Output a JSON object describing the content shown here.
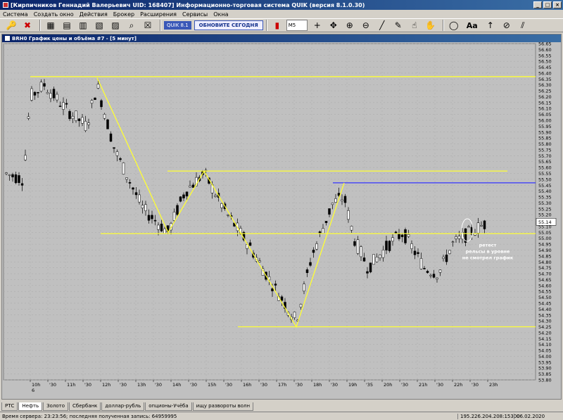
{
  "window": {
    "title": "[Кирпичников Геннадий Валерьевич UID: 168407] Информационно-торговая система QUIK (версия 8.1.0.30)"
  },
  "menu": [
    "Система",
    "Создать окно",
    "Действия",
    "Брокер",
    "Расширения",
    "Сервисы",
    "Окна"
  ],
  "toolbar": {
    "quik_badge": "QUIK 8.1",
    "update_label": "ОБНОВИТЕ СЕГОДНЯ",
    "timeframe": "M5",
    "text_tool": "Aa"
  },
  "chart": {
    "title": "BRH0 График цены и объёма #7 - [5 минут]",
    "current_price_label": "55.14",
    "annotation_lines": [
      "ретест",
      "рельсы в уровне",
      "не смотрел график"
    ],
    "date_label": "6"
  },
  "chart_data": {
    "type": "candlestick",
    "ylim": [
      53.8,
      56.65
    ],
    "y_tick_step": 0.05,
    "x_ticks": [
      "10h",
      "'30",
      "11h",
      "'30",
      "12h",
      "'30",
      "13h",
      "'30",
      "14h",
      "'30",
      "15h",
      "'30",
      "16h",
      "'30",
      "17h",
      "'30",
      "18h",
      "'30",
      "19h",
      "'35",
      "20h",
      "'30",
      "21h",
      "'30",
      "22h",
      "'30",
      "23h"
    ],
    "horizontal_levels": [
      {
        "value": 56.37,
        "color": "#ffff33"
      },
      {
        "value": 55.57,
        "color": "#ffff33"
      },
      {
        "value": 55.47,
        "color": "#3333ff"
      },
      {
        "value": 55.04,
        "color": "#ffff33"
      },
      {
        "value": 54.25,
        "color": "#ffff33"
      }
    ],
    "zigzag": [
      [
        135,
        56.36
      ],
      [
        236,
        55.05
      ],
      [
        287,
        55.57
      ],
      [
        418,
        54.25
      ],
      [
        486,
        55.47
      ]
    ],
    "current_price": 55.14
  },
  "tabs": [
    "РТС",
    "Нефть",
    "Золото",
    "Сбербанк",
    "доллар-рубль",
    "опционы-Учёба",
    "ищу развороты волн"
  ],
  "active_tab": 1,
  "status": {
    "server_time": "Время сервера: 23:23:56; последняя полученная запись: 64959995",
    "ip": "195.226.204.208:15300",
    "date": "06.02.2020"
  }
}
